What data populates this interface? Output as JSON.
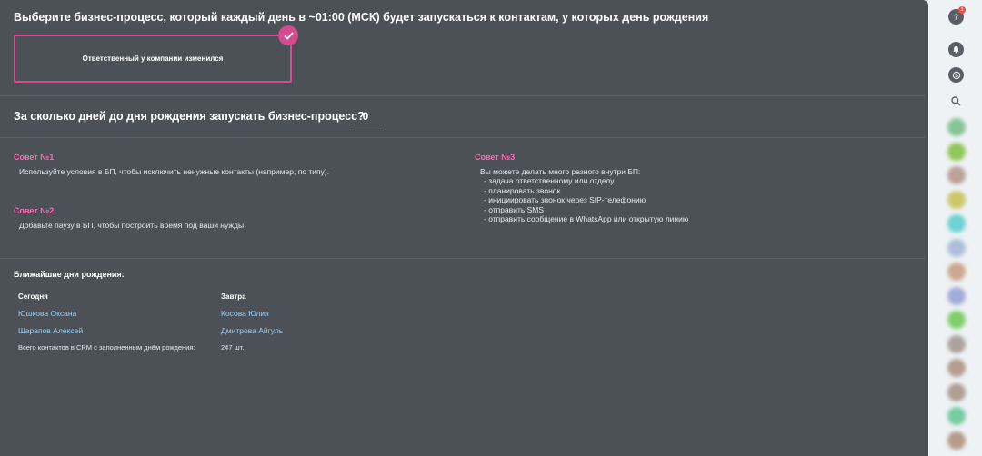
{
  "header": {
    "title": "Выберите бизнес-процесс, который каждый день в ~01:00 (МСК) будет запускаться к контактам, у которых день рождения"
  },
  "process_card": {
    "label": "Ответственный у компании изменился",
    "selected": true
  },
  "days_setting": {
    "label": "За сколько дней до дня рождения запускать бизнес-процесс?",
    "value": "0"
  },
  "tips": {
    "tip1": {
      "title": "Совет №1",
      "text": "Используйте условия в БП, чтобы исключить ненужные контакты (например, по типу)."
    },
    "tip2": {
      "title": "Совет №2",
      "text": "Добавьте паузу в БП, чтобы построить время под ваши нужды."
    },
    "tip3": {
      "title": "Совет №3",
      "lines": [
        "Вы можете делать много разного внутри БП:",
        "- задача ответственному или отделу",
        "- планировать звонок",
        "- инициировать звонок через SIP-телефонию",
        "- отправить SMS",
        "- отправить сообщение в WhatsApp или открытую линию"
      ]
    }
  },
  "birthdays": {
    "title": "Ближайшие дни рождения:",
    "today": {
      "header": "Сегодня",
      "people": [
        "Юшкова Оксана",
        "Шарапов Алексей"
      ]
    },
    "tomorrow": {
      "header": "Завтра",
      "people": [
        "Косова Юлия",
        "Дмитрова Айгуль"
      ]
    },
    "total_label": "Всего контактов в CRM с заполненным днём рождения:",
    "total_value": "247 шт."
  },
  "right_rail": {
    "help_badge_count": "1",
    "icons": [
      "help-icon",
      "bell-icon",
      "skype-icon",
      "search-icon"
    ],
    "avatar_colors": [
      "#7fc08f",
      "#86c24a",
      "#b89a8e",
      "#c9c25a",
      "#5ecfcf",
      "#a8b9d6",
      "#c8a087",
      "#9aa5d6",
      "#74cc5e",
      "#a49a95",
      "#b09383",
      "#a8958a",
      "#6ac79a",
      "#b0927f"
    ]
  },
  "colors": {
    "panel_bg": "#4b5156",
    "accent_pink": "#d64a8f",
    "tip_title": "#ff69b4",
    "link": "#9bd0f5"
  }
}
